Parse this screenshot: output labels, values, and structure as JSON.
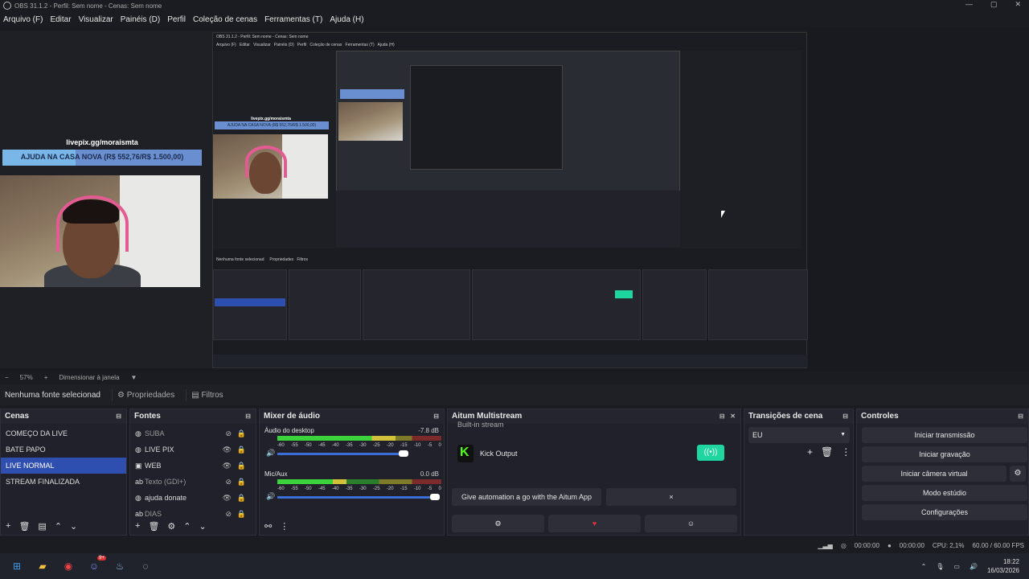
{
  "window": {
    "title": "OBS 31.1.2 - Perfil: Sem nome - Cenas: Sem nome"
  },
  "menu": [
    "Arquivo (F)",
    "Editar",
    "Visualizar",
    "Painéis (D)",
    "Perfil",
    "Coleção de cenas",
    "Ferramentas (T)",
    "Ajuda (H)"
  ],
  "overlay": {
    "livepix_handle": "livepix.gg/moraismta",
    "goal_text": "AJUDA NA CASA NOVA (R$ 552,76/R$ 1.500,00)",
    "goal_progress": 0.3685
  },
  "zoom": {
    "minus": "−",
    "value": "57%",
    "plus": "+",
    "fit": "Dimensionar à janela"
  },
  "source_bar": {
    "selected": "Nenhuma fonte selecionad",
    "properties": "Propriedades",
    "filters": "Filtros"
  },
  "scenes": {
    "title": "Cenas",
    "items": [
      {
        "label": "COMEÇO DA LIVE",
        "selected": false
      },
      {
        "label": "BATE PAPO",
        "selected": false
      },
      {
        "label": "LIVE NORMAL",
        "selected": true
      },
      {
        "label": "STREAM FINALIZADA",
        "selected": false
      }
    ]
  },
  "sources": {
    "title": "Fontes",
    "items": [
      {
        "label": "SUBA",
        "icon": "globe-icon",
        "visible": false
      },
      {
        "label": "LIVE PIX",
        "icon": "globe-icon",
        "visible": true
      },
      {
        "label": "WEB",
        "icon": "camera-icon",
        "visible": true
      },
      {
        "label": "Texto (GDI+)",
        "icon": "text-icon",
        "visible": false
      },
      {
        "label": "ajuda donate",
        "icon": "globe-icon",
        "visible": true
      },
      {
        "label": "DIAS",
        "icon": "text-icon",
        "visible": false
      }
    ]
  },
  "mixer": {
    "title": "Mixer de áudio",
    "channels": [
      {
        "name": "Áudio do desktop",
        "db": "-7.8 dB",
        "level": 0.72,
        "volume": 0.8
      },
      {
        "name": "Mic/Aux",
        "db": "0.0 dB",
        "level": 0.42,
        "volume": 1.0
      }
    ],
    "ticks": [
      "-60",
      "-55",
      "-50",
      "-45",
      "-40",
      "-35",
      "-30",
      "-25",
      "-20",
      "-15",
      "-10",
      "-5",
      "0"
    ]
  },
  "multistream": {
    "title": "Aitum Multistream",
    "built_in": "Built-in stream",
    "output": "Kick Output",
    "automation": "Give automation a go with the Aitum App",
    "close": "×"
  },
  "transitions": {
    "title": "Transições de cena",
    "selected": "EU"
  },
  "controls": {
    "title": "Controles",
    "buttons": [
      "Iniciar transmissão",
      "Iniciar gravação",
      "Iniciar câmera virtual",
      "Modo estúdio",
      "Configurações"
    ]
  },
  "status": {
    "rec": "00:00:00",
    "stream": "00:00:00",
    "cpu": "CPU: 2,1%",
    "fps": "60.00 / 60.00 FPS"
  },
  "taskbar": {
    "time": "18:22",
    "date": "16/03/2026",
    "discord_badge": "9+"
  },
  "colors": {
    "accent": "#2f4fb0",
    "kick_green": "#53fc18",
    "toggle": "#1fd6a0"
  }
}
